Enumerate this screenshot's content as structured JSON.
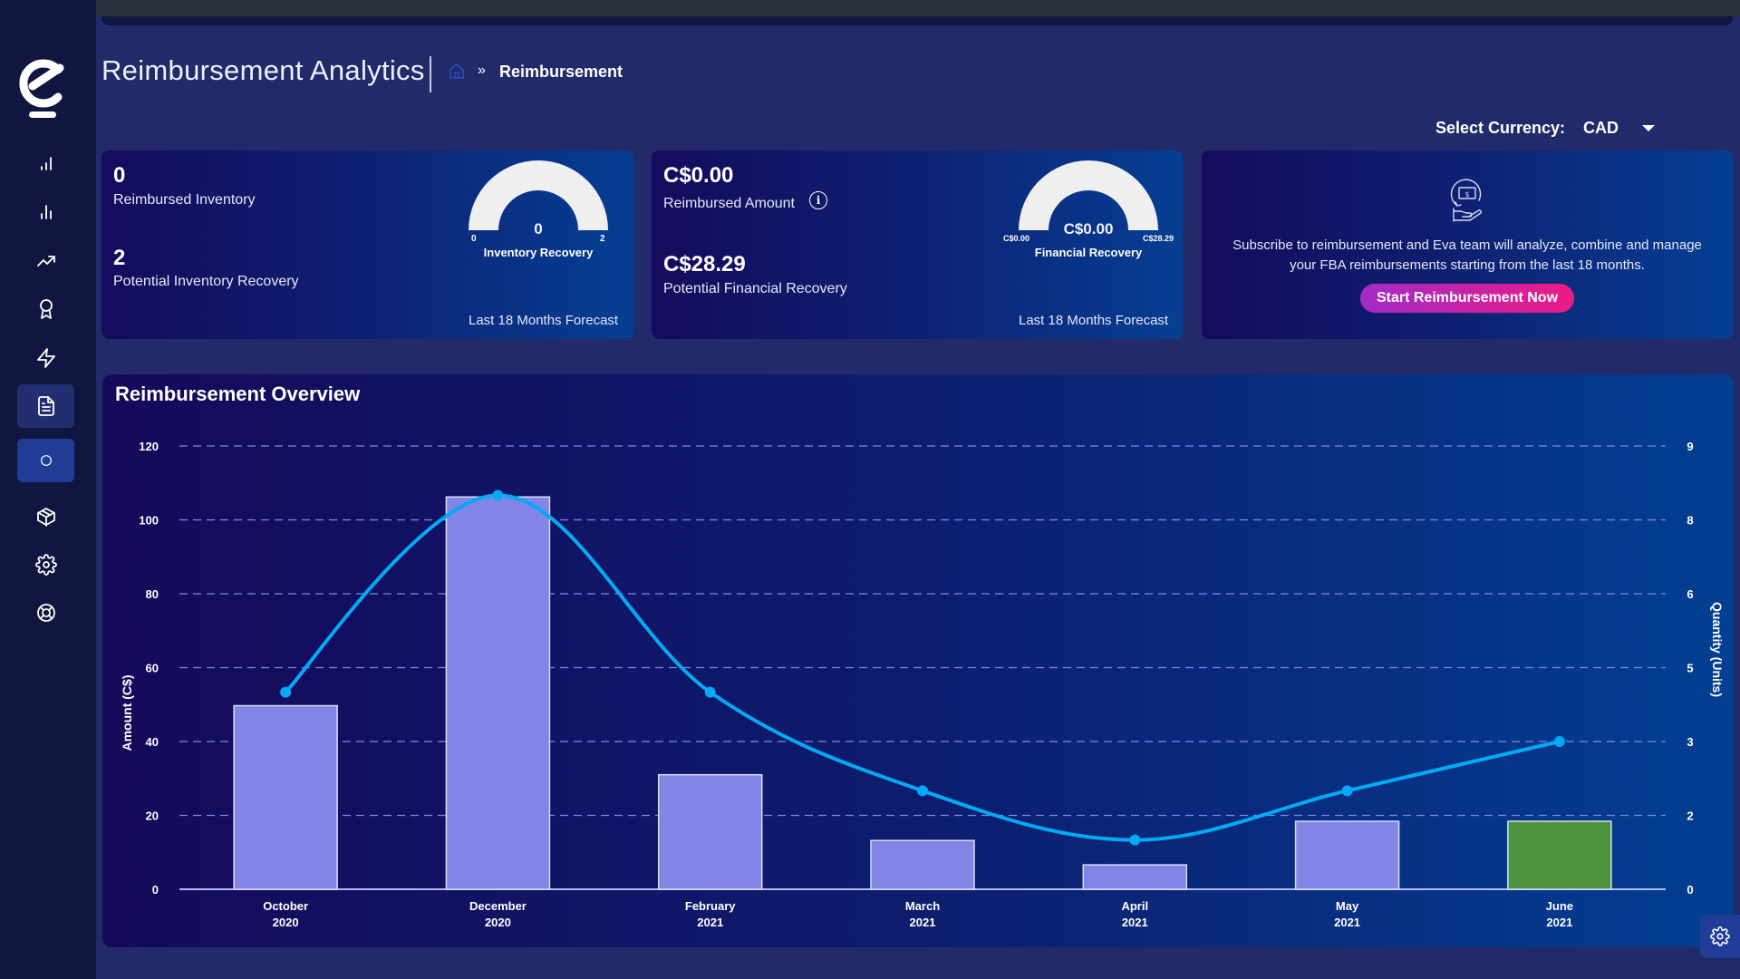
{
  "header": {
    "title": "Reimbursement Analytics",
    "breadcrumb_separator": "»",
    "breadcrumb_current": "Reimbursement",
    "home_icon": "home-icon"
  },
  "sidebar": {
    "logo": "eva-logo",
    "items": [
      {
        "icon": "signal-bars-icon",
        "active": false
      },
      {
        "icon": "bar-chart-icon",
        "active": false
      },
      {
        "icon": "trending-up-icon",
        "active": false
      },
      {
        "icon": "award-icon",
        "active": false
      },
      {
        "icon": "lightning-icon",
        "active": false
      },
      {
        "icon": "document-icon",
        "active": true
      },
      {
        "icon": "circle-icon",
        "active": true
      },
      {
        "icon": "box-icon",
        "active": false
      },
      {
        "icon": "settings-icon",
        "active": false
      },
      {
        "icon": "lifebuoy-icon",
        "active": false
      }
    ]
  },
  "currency": {
    "label": "Select Currency:",
    "selected": "CAD"
  },
  "cards": {
    "inventory": {
      "reimbursed_value": "0",
      "reimbursed_label": "Reimbursed Inventory",
      "potential_value": "2",
      "potential_label": "Potential Inventory Recovery",
      "gauge": {
        "value": "0",
        "min": "0",
        "max": "2",
        "label": "Inventory Recovery",
        "fill_fraction": 0
      },
      "forecast": "Last 18 Months Forecast"
    },
    "financial": {
      "reimbursed_value": "C$0.00",
      "reimbursed_label": "Reimbursed Amount",
      "info_icon": "i",
      "potential_value": "C$28.29",
      "potential_label": "Potential Financial Recovery",
      "gauge": {
        "value": "C$0.00",
        "min": "C$0.00",
        "max": "C$28.29",
        "label": "Financial Recovery",
        "fill_fraction": 0
      },
      "forecast": "Last 18 Months Forecast"
    },
    "subscribe": {
      "icon": "money-hand-icon",
      "text": "Subscribe to reimbursement and Eva team will analyze, combine and manage your FBA reimbursements starting from the last 18 months.",
      "button": "Start Reimbursement Now"
    }
  },
  "chart_data": {
    "type": "bar",
    "title": "Reimbursement Overview",
    "categories": [
      [
        "October",
        "2020"
      ],
      [
        "December",
        "2020"
      ],
      [
        "February",
        "2021"
      ],
      [
        "March",
        "2021"
      ],
      [
        "April",
        "2021"
      ],
      [
        "May",
        "2021"
      ],
      [
        "June",
        "2021"
      ]
    ],
    "series": [
      {
        "name": "Amount (C$)",
        "type": "bar",
        "axis": "left",
        "values": [
          49.7,
          106.2,
          31.0,
          13.2,
          6.6,
          18.4,
          18.4
        ],
        "colors": [
          "#8085e6",
          "#8085e6",
          "#8085e6",
          "#8085e6",
          "#8085e6",
          "#8085e6",
          "#4d943e"
        ]
      },
      {
        "name": "Quantity (Units)",
        "type": "line",
        "axis": "right",
        "smooth": true,
        "color": "#03a9f4",
        "values": [
          4,
          8,
          4,
          2,
          1,
          2,
          3
        ]
      }
    ],
    "ylabel": "Amount (C$)",
    "ylabel_right": "Quantity (Units)",
    "ylim": [
      0,
      120
    ],
    "ylim_right": [
      0,
      9
    ],
    "yticks": [
      "0",
      "20",
      "40",
      "60",
      "80",
      "100",
      "120"
    ],
    "yticks_right": [
      "0",
      "2",
      "3",
      "5",
      "6",
      "8",
      "9"
    ],
    "grid": true,
    "grid_color": "#7f87e8"
  },
  "floating_button": {
    "icon": "settings-icon"
  }
}
